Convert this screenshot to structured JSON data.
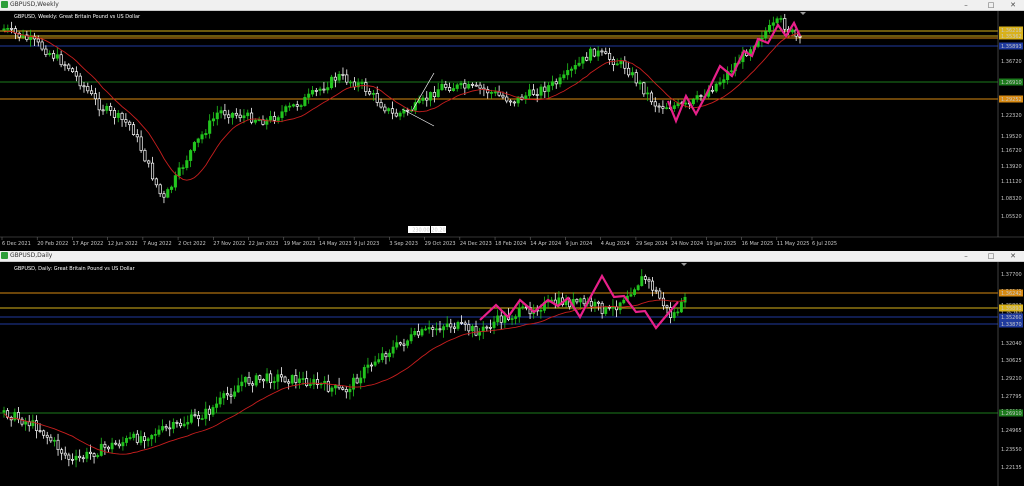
{
  "colors": {
    "background": "#000000",
    "bull": "#22c41e",
    "bear": "#ffffff",
    "ma": "#c81e1e",
    "pattern": "#e8208a",
    "level_orange": "#d88a12",
    "level_yellow": "#d9b21a",
    "level_blue": "#1f3a9e",
    "level_green": "#1c7a1c",
    "grid_axis": "#6a6a6a"
  },
  "weekly": {
    "window_title": "GBPUSD,Weekly",
    "chart_header": "GBPUSD, Weekly: Great Britain Pound vs US Dollar",
    "price_labels": [
      "1.36720",
      "1.28440",
      "1.22320",
      "1.19520",
      "1.16720",
      "1.13920",
      "1.11120",
      "1.08320",
      "1.05520"
    ],
    "level_tags": [
      "1.36218",
      "1.35362",
      "1.35893",
      "1.26910",
      "1.29252"
    ],
    "date_labels": [
      "6 Dec 2021",
      "20 Feb 2022",
      "17 Apr 2022",
      "12 Jun 2022",
      "7 Aug 2022",
      "2 Oct 2022",
      "27 Nov 2022",
      "22 Jan 2023",
      "19 Mar 2023",
      "14 May 2023",
      "9 Jul 2023",
      "3 Sep 2023",
      "29 Oct 2023",
      "24 Dec 2023",
      "18 Feb 2024",
      "14 Apr 2024",
      "9 Jun 2024",
      "4 Aug 2024",
      "29 Sep 2024",
      "24 Nov 2024",
      "19 Jan 2025",
      "16 Mar 2025",
      "11 May 2025",
      "6 Jul 2025"
    ],
    "crosshair_tags": [
      "21",
      "30.00",
      "20.20"
    ]
  },
  "daily": {
    "window_title": "GBPUSD,Daily",
    "chart_header": "GBPUSD, Daily: Great Britain Pound vs US Dollar",
    "price_labels": [
      "1.37700",
      "1.36242",
      "1.35893",
      "1.35260",
      "1.33870",
      "1.32040",
      "1.30625",
      "1.29210",
      "1.27795",
      "1.26910",
      "1.24965",
      "1.23550",
      "1.22135"
    ],
    "level_tags": [
      "1.36242",
      "1.35893",
      "1.35260",
      "1.33870",
      "1.26910"
    ]
  },
  "window_buttons": {
    "min": "–",
    "max": "□",
    "close": "✕"
  }
}
